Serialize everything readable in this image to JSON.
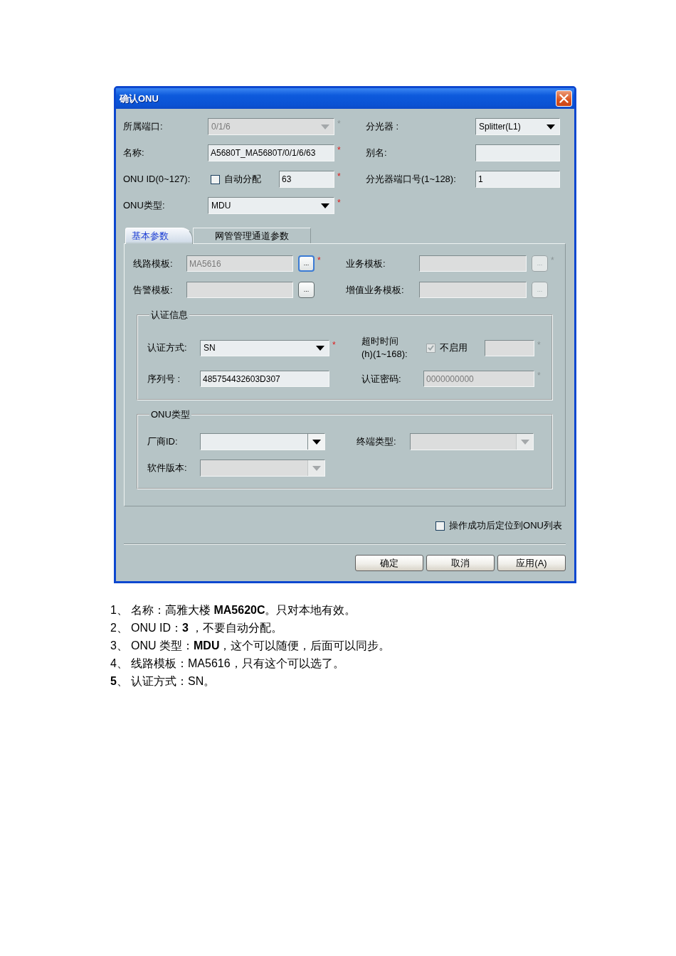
{
  "window": {
    "title": "确认ONU"
  },
  "general_fields": [
    {
      "kind": "dropdown",
      "label": "所属端口:",
      "value": "0/1/6",
      "disabled": true,
      "required_mark": "*"
    },
    {
      "kind": "text",
      "label": "名称:",
      "value": "A5680T_MA5680T/0/1/6/63",
      "disabled": false,
      "required_mark": "*"
    },
    {
      "kind": "checkbox_text",
      "label": "ONU ID(0~127):",
      "checkbox_label": "自动分配",
      "checked": false,
      "value": "63",
      "disabled": false,
      "required_mark": "*"
    },
    {
      "kind": "dropdown",
      "label": "ONU类型:",
      "value": "MDU",
      "disabled": false,
      "required_mark": "*"
    }
  ],
  "splitter_fields": [
    {
      "kind": "dropdown",
      "label": "分光器 :",
      "value": "Splitter(L1)",
      "disabled": false
    },
    {
      "kind": "text",
      "label": "别名:",
      "disabled": false
    },
    {
      "kind": "text",
      "label": "分光器端口号(1~128):",
      "value": "1",
      "disabled": false
    }
  ],
  "tabs": [
    {
      "label": "基本参数",
      "selected": true
    },
    {
      "label": "网管管理通道参数",
      "selected": false
    }
  ],
  "template_fields": [
    {
      "kind": "browse",
      "label": "线路模板:",
      "value": "MA5616",
      "disabled": true,
      "button": "...",
      "button_focused": true,
      "button_disabled": false,
      "required_mark": "*"
    },
    {
      "kind": "browse",
      "label": "业务模板:",
      "disabled": true,
      "button": "...",
      "button_focused": false,
      "button_disabled": true,
      "required_mark": "*"
    },
    {
      "kind": "browse",
      "label": "告警模板:",
      "disabled": true,
      "button": "...",
      "button_focused": false,
      "button_disabled": false
    },
    {
      "kind": "browse",
      "label": "增值业务模板:",
      "disabled": true,
      "button": "...",
      "button_focused": false,
      "button_disabled": true
    }
  ],
  "auth_group": {
    "title": "认证信息",
    "fields": [
      {
        "kind": "dropdown",
        "label": "认证方式:",
        "value": "SN",
        "disabled": false,
        "required_mark": "*"
      },
      {
        "kind": "checkbox_text",
        "label": "超时时间\n(h)(1~168):",
        "checkbox_label": "不启用",
        "checked": true,
        "disabled": true,
        "required_mark": "*"
      },
      {
        "kind": "text",
        "label": "序列号 :",
        "value": "485754432603D307",
        "disabled": false
      },
      {
        "kind": "text",
        "label": "认证密码:",
        "value": "0000000000",
        "disabled": true,
        "required_mark": "*"
      }
    ]
  },
  "onu_type_group": {
    "title": "ONU类型",
    "fields": [
      {
        "kind": "combo",
        "label": "厂商ID:",
        "disabled": false
      },
      {
        "kind": "combo",
        "label": "终端类型:",
        "disabled": true
      },
      {
        "kind": "combo",
        "label": "软件版本:",
        "disabled": true
      }
    ]
  },
  "locate_option": {
    "label": "操作成功后定位到ONU列表",
    "checked": false
  },
  "buttons": [
    "确定",
    "取消",
    "应用(A)"
  ],
  "notes": [
    {
      "number": "1、",
      "text": "名称：高雅大楼 **MA5620C**。只对本地有效。"
    },
    {
      "number": "2、",
      "text": "ONU ID：**3** ，不要自动分配。"
    },
    {
      "number": "3、",
      "text": "ONU 类型：**MDU**，这个可以随便，后面可以同步。"
    },
    {
      "number": "4、",
      "text": "线路模板：MA5616，只有这个可以选了。"
    },
    {
      "number": "**5**、",
      "text": "认证方式：SN。"
    }
  ]
}
